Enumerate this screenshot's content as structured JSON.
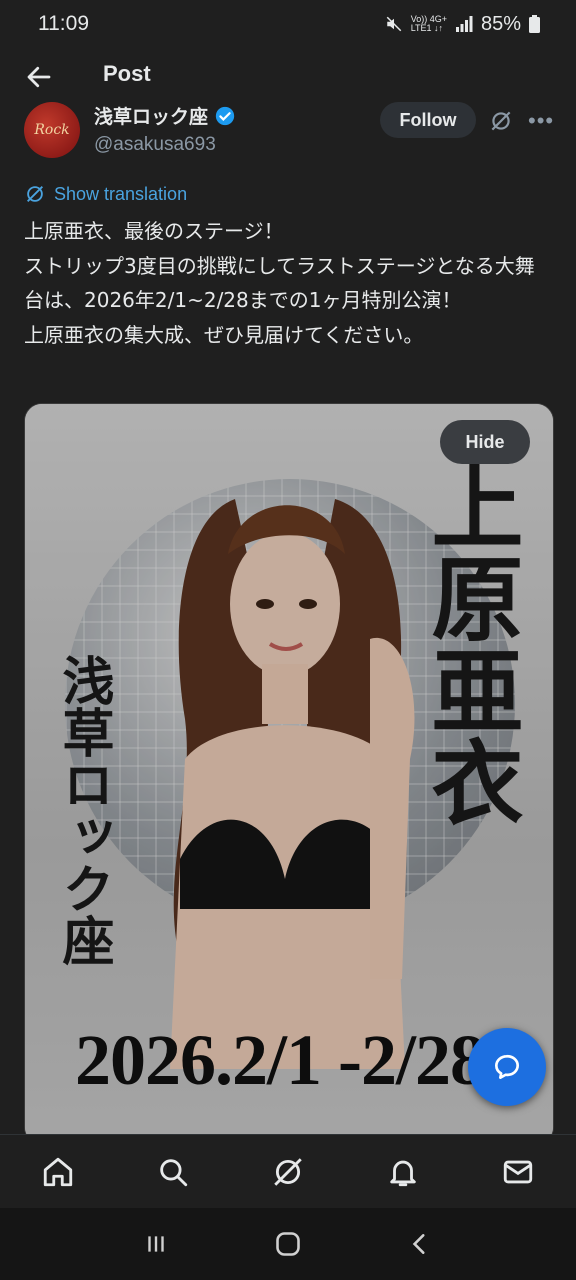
{
  "status_bar": {
    "time": "11:09",
    "network_top": "Vo)) 4G+",
    "network_bottom": "LTE1 ↓↑",
    "battery": "85%"
  },
  "header": {
    "title": "Post"
  },
  "author": {
    "name": "浅草ロック座",
    "handle": "@asakusa693",
    "avatar_text": "Rock",
    "follow_label": "Follow"
  },
  "post": {
    "translation_label": "Show translation",
    "text": "上原亜衣、最後のステージ！\nストリップ3度目の挑戦にしてラストステージとなる大舞台は、2026年2/1~2/28までの1ヶ月特別公演！\n上原亜衣の集大成、ぜひ見届けてください。"
  },
  "media": {
    "hide_label": "Hide",
    "poster_name": "上原亜衣",
    "poster_theatre": "浅草ロック座",
    "poster_date": "2026.2/1 -2/28"
  },
  "colors": {
    "background": "#1f1f1f",
    "link": "#4aa3df",
    "fab": "#1d6fe0",
    "verified": "#1d9bf0"
  },
  "nav": {
    "items": [
      "home-icon",
      "search-icon",
      "grok-icon",
      "notifications-icon",
      "messages-icon"
    ]
  }
}
